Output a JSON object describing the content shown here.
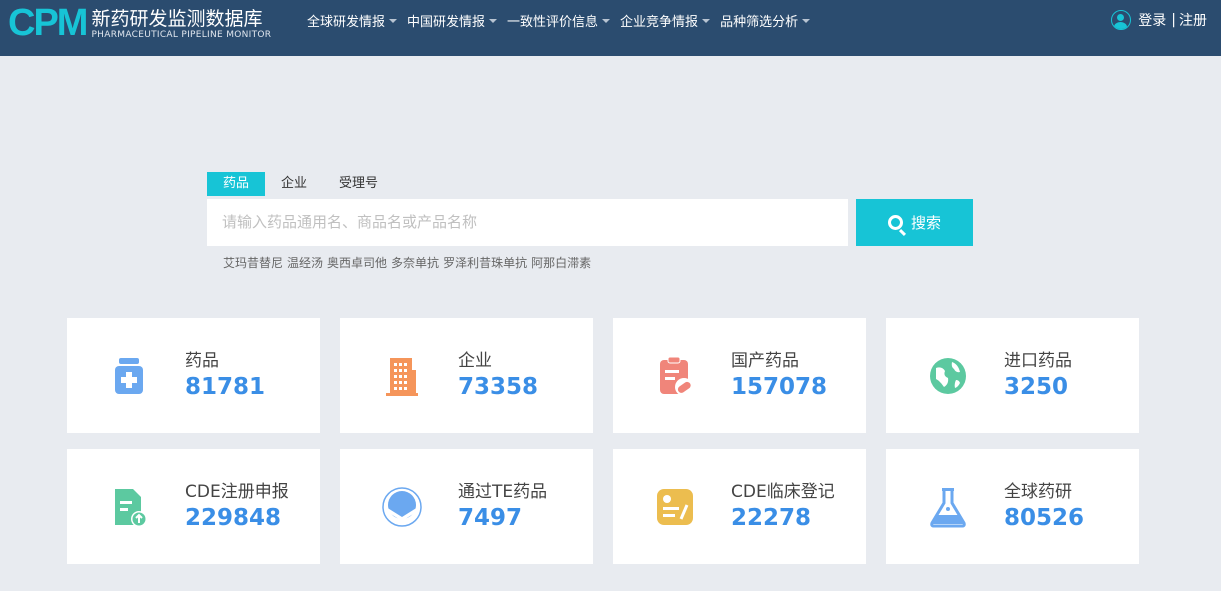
{
  "brand": {
    "logo": "CPM",
    "name_cn": "新药研发监测数据库",
    "name_en": "PHARMACEUTICAL PIPELINE MONITOR"
  },
  "menu": [
    "全球研发情报",
    "中国研发情报",
    "一致性评价信息",
    "企业竞争情报",
    "品种筛选分析"
  ],
  "user": {
    "login": "登录",
    "sep": "|",
    "register": "注册"
  },
  "search": {
    "tabs": [
      "药品",
      "企业",
      "受理号"
    ],
    "placeholder": "请输入药品通用名、商品名或产品名称",
    "button": "搜索",
    "hot": [
      "艾玛昔替尼",
      "温经汤",
      "奥西卓司他",
      "多奈单抗",
      "罗泽利昔珠单抗",
      "阿那白滞素"
    ]
  },
  "stats": [
    {
      "label": "药品",
      "value": "81781",
      "icon": "medicine-bottle-icon",
      "color": "#6ba8f0"
    },
    {
      "label": "企业",
      "value": "73358",
      "icon": "building-icon",
      "color": "#f5955a"
    },
    {
      "label": "国产药品",
      "value": "157078",
      "icon": "clipboard-pill-icon",
      "color": "#f0857a"
    },
    {
      "label": "进口药品",
      "value": "3250",
      "icon": "globe-icon",
      "color": "#5cc9a0"
    },
    {
      "label": "CDE注册申报",
      "value": "229848",
      "icon": "document-upload-icon",
      "color": "#5cc9a0"
    },
    {
      "label": "通过TE药品",
      "value": "7497",
      "icon": "consistency-badge-icon",
      "color": "#6ba8f0"
    },
    {
      "label": "CDE临床登记",
      "value": "22278",
      "icon": "register-note-icon",
      "color": "#ecbd4f"
    },
    {
      "label": "全球药研",
      "value": "80526",
      "icon": "flask-icon",
      "color": "#6ba8f0"
    }
  ]
}
